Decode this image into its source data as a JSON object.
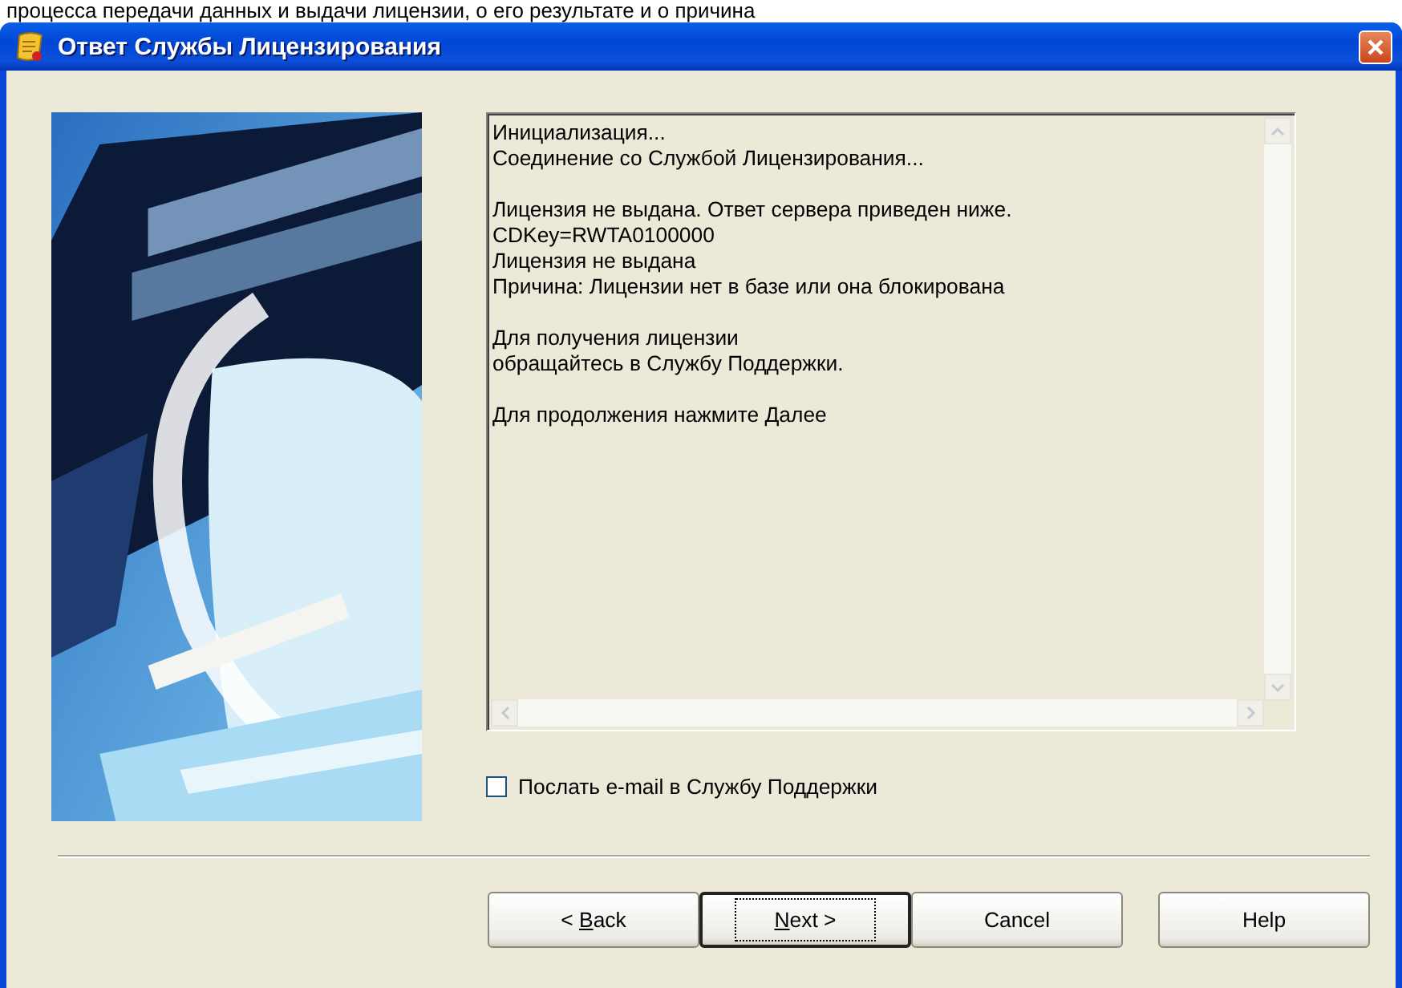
{
  "caption_above": "процесса передачи данных и выдачи лицензии, о его результате и о причина",
  "window": {
    "title": "Ответ Службы Лицензирования"
  },
  "log": {
    "paragraphs": [
      [
        "Инициализация...",
        "Соединение со Службой Лицензирования..."
      ],
      [
        "Лицензия не выдана. Ответ сервера приведен ниже.",
        "CDKey=RWTA0100000",
        "Лицензия не выдана",
        "Причина: Лицензии нет в базе или она блокирована"
      ],
      [
        "Для получения лицензии",
        "обращайтесь в Службу Поддержки."
      ],
      [
        "Для продолжения нажмите Далее"
      ]
    ]
  },
  "email_checkbox": {
    "label": "Послать e-mail в Службу Поддержки",
    "checked": false
  },
  "buttons": [
    {
      "before": "< ",
      "key": "B",
      "after": "ack",
      "default": false
    },
    {
      "key": "N",
      "after": "ext >",
      "default": true
    },
    {
      "before": "Cancel",
      "default": false
    },
    {
      "before": "Help",
      "default": false
    }
  ]
}
